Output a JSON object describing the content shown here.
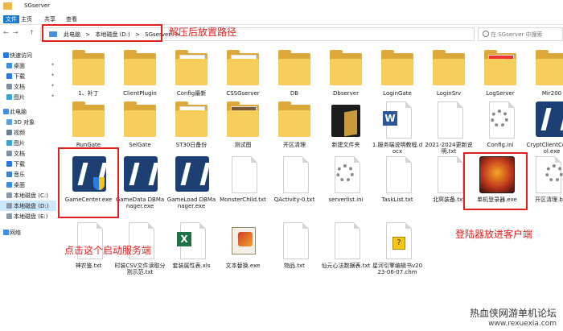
{
  "window": {
    "title": "SGserver"
  },
  "ribbon": {
    "tabs": [
      "文件",
      "主页",
      "共享",
      "查看"
    ]
  },
  "nav": {
    "back": "←",
    "forward": "→",
    "up": "↑",
    "crumbs": [
      "此电脑",
      ">",
      "本地磁盘 (D:)",
      ">",
      "SGserver",
      ">"
    ],
    "search_placeholder": "在 SGserver 中搜索"
  },
  "annotations": {
    "path": "解压后放置路径",
    "server": "点击这个启动服务端",
    "client": "登陆器放进客户端"
  },
  "sidebar": {
    "items": [
      {
        "label": "快速访问",
        "icon": "star-icon",
        "color": "#2b78e4"
      },
      {
        "label": "桌面",
        "icon": "desktop-icon",
        "color": "#3a8ee6",
        "pinned": true
      },
      {
        "label": "下载",
        "icon": "download-icon",
        "color": "#2b78e4",
        "pinned": true
      },
      {
        "label": "文档",
        "icon": "document-icon",
        "color": "#7d8fa5",
        "pinned": true
      },
      {
        "label": "图片",
        "icon": "picture-icon",
        "color": "#3aa3d6",
        "pinned": true
      },
      {
        "label": "此电脑",
        "icon": "computer-icon",
        "color": "#4a90d9"
      },
      {
        "label": "3D 对象",
        "icon": "cube-icon",
        "color": "#5aa0e0"
      },
      {
        "label": "视频",
        "icon": "video-icon",
        "color": "#6b7f95"
      },
      {
        "label": "图片",
        "icon": "picture-icon",
        "color": "#3aa3d6"
      },
      {
        "label": "文档",
        "icon": "document-icon",
        "color": "#7d8fa5"
      },
      {
        "label": "下载",
        "icon": "download-icon",
        "color": "#2b78e4"
      },
      {
        "label": "音乐",
        "icon": "music-icon",
        "color": "#3d7fd0"
      },
      {
        "label": "桌面",
        "icon": "desktop-icon",
        "color": "#3a8ee6"
      },
      {
        "label": "本地磁盘 (C:)",
        "icon": "drive-icon",
        "color": "#8a9aa8"
      },
      {
        "label": "本地磁盘 (D:)",
        "icon": "drive-icon",
        "color": "#8a9aa8",
        "selected": true
      },
      {
        "label": "本地磁盘 (E:)",
        "icon": "drive-icon",
        "color": "#8a9aa8"
      },
      {
        "label": "网络",
        "icon": "network-icon",
        "color": "#3a8ee6"
      }
    ]
  },
  "files": {
    "row1": [
      "1、补丁",
      "ClientPlugin",
      "Config最新",
      "CSSGserver",
      "DB",
      "Dbserver",
      "LoginGate",
      "LoginSrv",
      "LogServer",
      "Mir200"
    ],
    "row2": [
      "RunGate",
      "SelGate",
      "ST30日备份",
      "测试图",
      "开区清理",
      "新建文件夹",
      "1.服务端说明教程.docx",
      "2021-2024更新说明.txt",
      "Config.ini",
      "CryptClientConfTool.exe"
    ],
    "row3": [
      "GameCenter.exe",
      "GameData DBManager.exe",
      "GameLoad DBManager.exe",
      "MonsterChild.txt",
      "QActivity-0.txt",
      "serverlist.ini",
      "TaskList.txt",
      "北冥装备.txt",
      "单机登录器.exe",
      "开区清理.bat"
    ],
    "row4": [
      "神农鉴.txt",
      "时装CSV文件读取分割示范.txt",
      "套装属性表.xls",
      "文本替换.exe",
      "物品.txt",
      "仙元心法数据表.txt",
      "星河引擎编辑书v2023-06-07.chm"
    ]
  },
  "watermark": {
    "title": "热血侠网游单机论坛",
    "url": "www.rexuexia.com"
  },
  "colors": {
    "folder": "#f7ce5b",
    "annotation": "#e02020",
    "accent": "#2b78e4"
  }
}
